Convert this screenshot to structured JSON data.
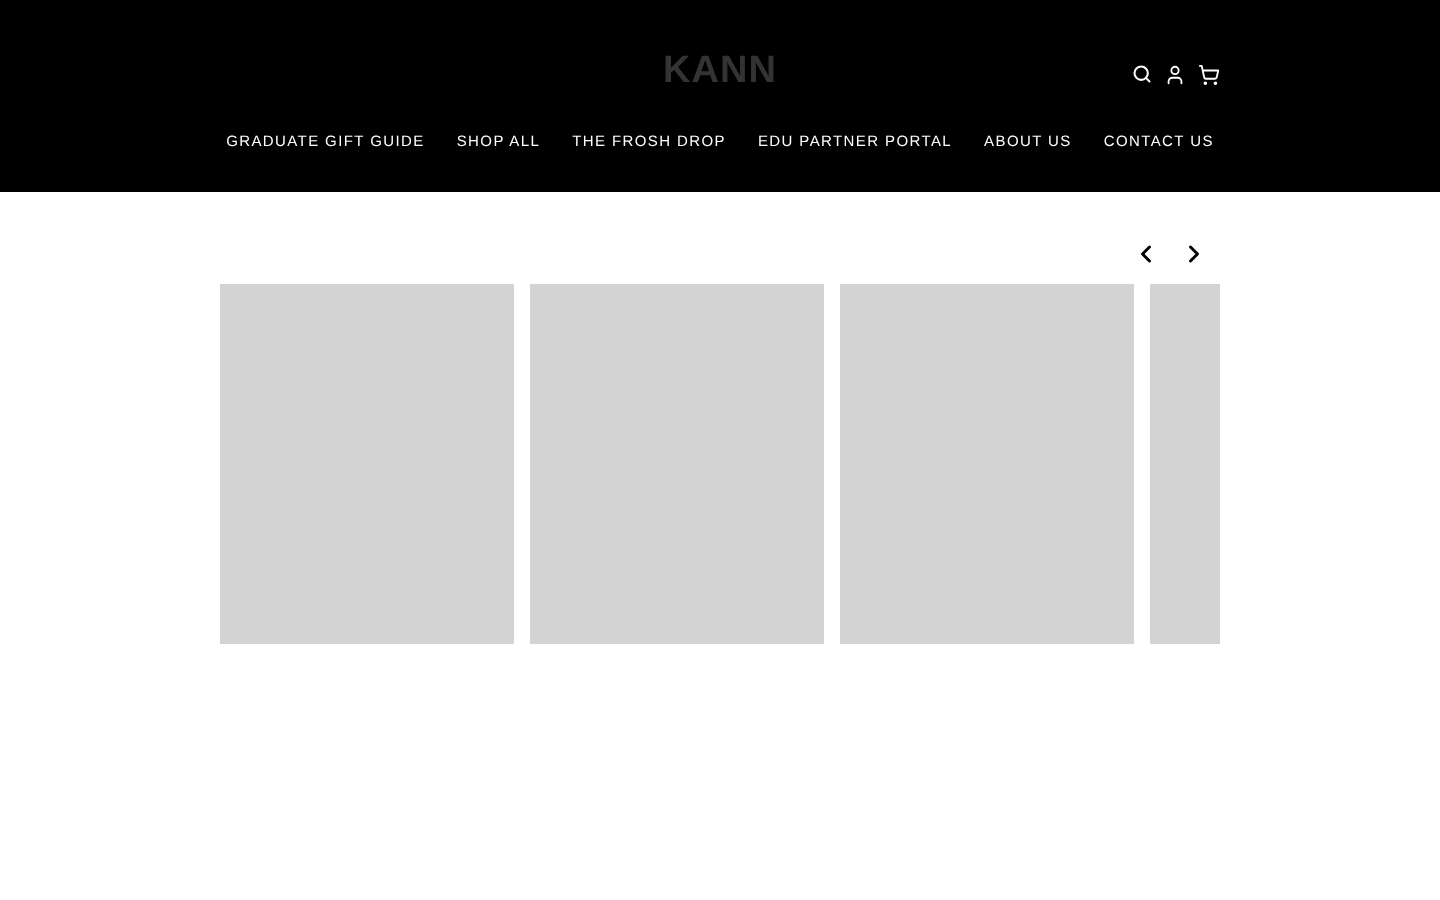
{
  "header": {
    "logo": "KANN",
    "nav": [
      {
        "label": "GRADUATE GIFT GUIDE"
      },
      {
        "label": "SHOP ALL"
      },
      {
        "label": "THE FROSH DROP"
      },
      {
        "label": "EDU PARTNER PORTAL"
      },
      {
        "label": "ABOUT US"
      },
      {
        "label": "CONTACT US"
      }
    ]
  },
  "carousel": {
    "slides": [
      {
        "kind": "placeholder"
      },
      {
        "kind": "placeholder"
      },
      {
        "kind": "placeholder"
      },
      {
        "kind": "placeholder"
      }
    ]
  }
}
